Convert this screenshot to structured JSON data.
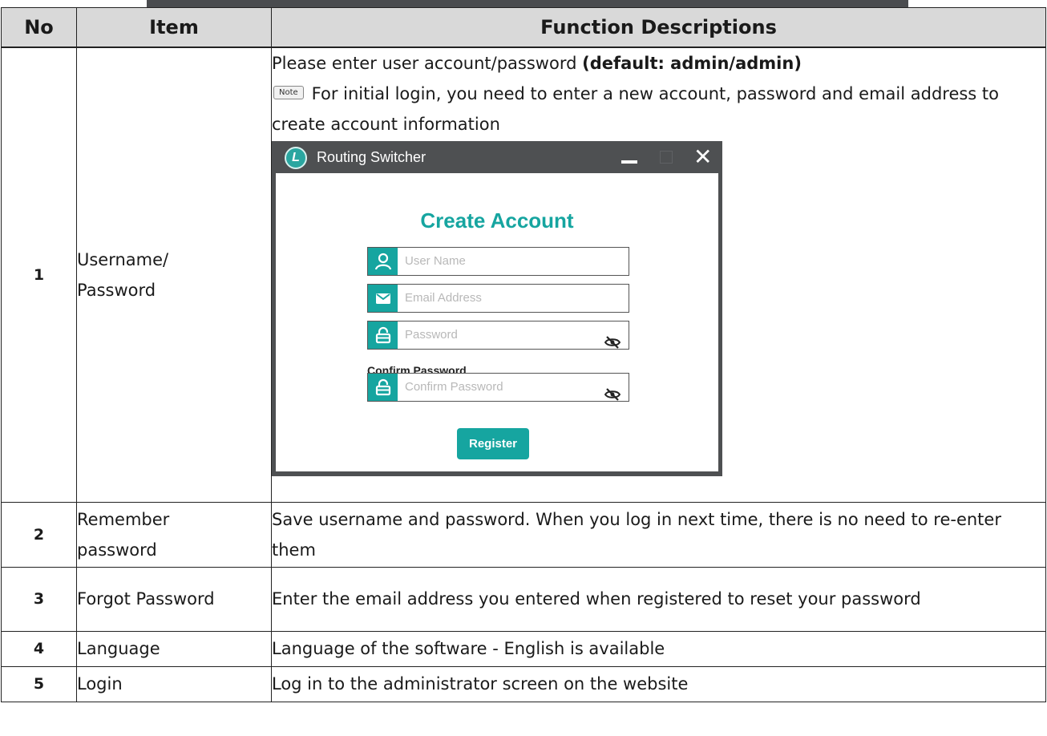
{
  "table": {
    "headers": {
      "no": "No",
      "item": "Item",
      "desc": "Function Descriptions"
    },
    "rows": [
      {
        "no": "1",
        "item_line1": "Username/",
        "item_line2": "Password",
        "desc_line1_prefix": "Please enter user account/password ",
        "desc_line1_bold": "(default: admin/admin)",
        "note_badge": "Note",
        "note_text": "For initial login, you need to enter a new account, password and email address to create account information"
      },
      {
        "no": "2",
        "item_line1": "Remember",
        "item_line2": "password",
        "desc": "Save username and password. When you log in next time, there is no need to re-enter them"
      },
      {
        "no": "3",
        "item": "Forgot Password",
        "desc": "Enter the email address you entered when registered to reset your password"
      },
      {
        "no": "4",
        "item": "Language",
        "desc": "Language of the software - English is available"
      },
      {
        "no": "5",
        "item": "Login",
        "desc": "Log in to the administrator screen on the website"
      }
    ]
  },
  "window": {
    "logo_letter": "L",
    "title": "Routing Switcher",
    "close_glyph": "✕",
    "heading": "Create Account",
    "fields": {
      "username_placeholder": "User Name",
      "email_placeholder": "Email Address",
      "password_placeholder": "Password",
      "confirm_label": "Confirm Password",
      "confirm_placeholder": "Confirm Password"
    },
    "register_label": "Register",
    "accent_color": "#16a5a0"
  }
}
